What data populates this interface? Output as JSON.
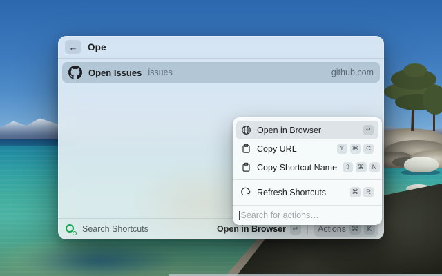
{
  "window": {
    "header": {
      "back_glyph": "←",
      "query": "Ope"
    },
    "list": [
      {
        "icon": "github-icon",
        "title": "Open Issues",
        "subtitle": "issues",
        "accessory": "github.com",
        "selected": true
      }
    ],
    "footer": {
      "app_icon": "shortcuts-green-icon",
      "app_name": "Search Shortcuts",
      "primary_label": "Open in Browser",
      "primary_key": "↵",
      "actions_label": "Actions",
      "actions_keys": [
        "⌘",
        "K"
      ]
    }
  },
  "actions_menu": {
    "items": [
      {
        "icon": "globe-icon",
        "label": "Open in Browser",
        "keys": [
          "↵"
        ],
        "selected": true
      },
      {
        "icon": "clipboard-icon",
        "label": "Copy URL",
        "keys": [
          "⇧",
          "⌘",
          "C"
        ]
      },
      {
        "icon": "clipboard-icon",
        "label": "Copy Shortcut Name",
        "keys": [
          "⇧",
          "⌘",
          "N"
        ]
      },
      {
        "icon": "refresh-icon",
        "label": "Refresh Shortcuts",
        "keys": [
          "⌘",
          "R"
        ]
      }
    ],
    "search_placeholder": "Search for actions…"
  },
  "colors": {
    "accent_green": "#17a24b",
    "selection_gray_blue": "rgba(122,146,167,0.38)",
    "sky_top": "#2b68ae",
    "water_teal": "#41ad9f"
  }
}
